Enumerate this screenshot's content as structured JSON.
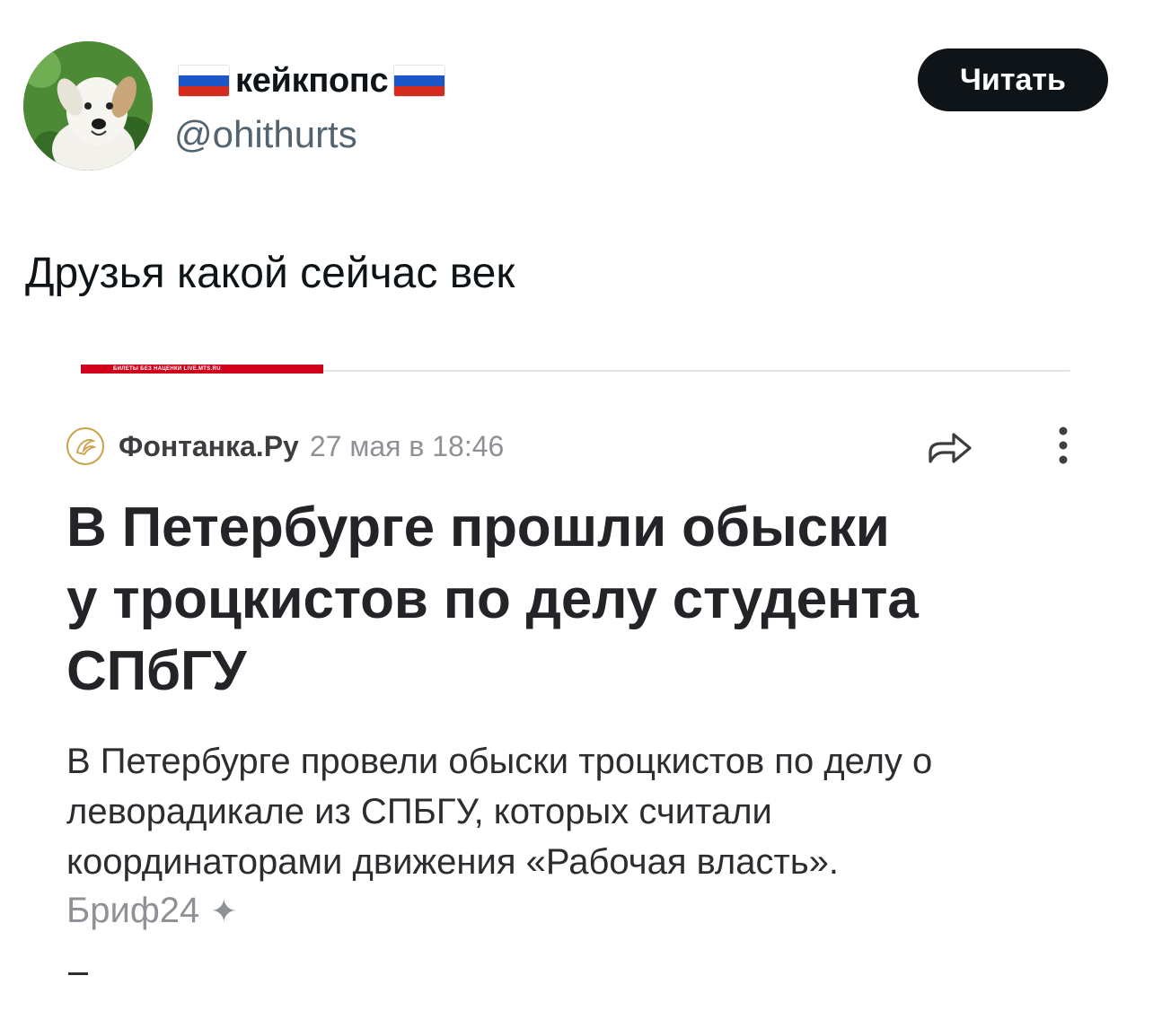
{
  "tweet": {
    "display_name": "кейкпопс",
    "handle": "@ohithurts",
    "follow_label": "Читать",
    "text": "Друзья какой сейчас век",
    "flag_colors": [
      "#ffffff",
      "#1c57c8",
      "#d52b1e"
    ]
  },
  "article": {
    "ad_text": "БИЛЕТЫ БЕЗ НАЦЕНКИ LIVE.MTS.RU",
    "source_name": "Фонтанка.Ру",
    "date": "27 мая в 18:46",
    "headline_lines": [
      "В Петербурге прошли обыски",
      "у троцкистов по делу студента",
      "СПбГУ"
    ],
    "summary_lines": [
      "В Петербурге провели обыски троцкистов по делу о",
      "леворадикале из СПБГУ, которых считали",
      "координаторами движения «Рабочая власть»."
    ],
    "brief_label": "Бриф24",
    "brief_icon": "sparkle-icon"
  },
  "colors": {
    "accent_dark": "#0f1419",
    "ad_red": "#d0021b",
    "muted": "#8e9196"
  }
}
